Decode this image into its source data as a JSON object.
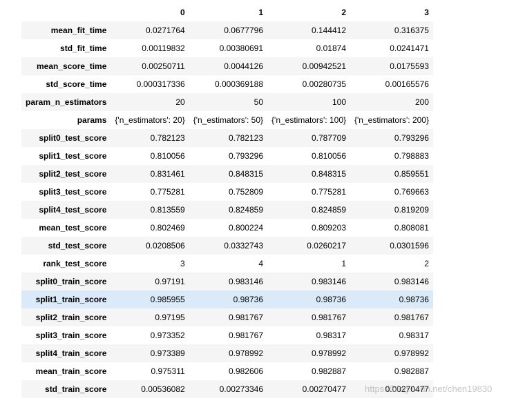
{
  "table": {
    "columns": [
      "0",
      "1",
      "2",
      "3"
    ],
    "hover_row_index": 15,
    "rows": [
      {
        "label": "mean_fit_time",
        "values": [
          "0.0271764",
          "0.0677796",
          "0.144412",
          "0.316375"
        ]
      },
      {
        "label": "std_fit_time",
        "values": [
          "0.00119832",
          "0.00380691",
          "0.01874",
          "0.0241471"
        ]
      },
      {
        "label": "mean_score_time",
        "values": [
          "0.00250711",
          "0.0044126",
          "0.00942521",
          "0.0175593"
        ]
      },
      {
        "label": "std_score_time",
        "values": [
          "0.000317336",
          "0.000369188",
          "0.00280735",
          "0.00165576"
        ]
      },
      {
        "label": "param_n_estimators",
        "values": [
          "20",
          "50",
          "100",
          "200"
        ]
      },
      {
        "label": "params",
        "values": [
          "{'n_estimators': 20}",
          "{'n_estimators': 50}",
          "{'n_estimators': 100}",
          "{'n_estimators': 200}"
        ]
      },
      {
        "label": "split0_test_score",
        "values": [
          "0.782123",
          "0.782123",
          "0.787709",
          "0.793296"
        ]
      },
      {
        "label": "split1_test_score",
        "values": [
          "0.810056",
          "0.793296",
          "0.810056",
          "0.798883"
        ]
      },
      {
        "label": "split2_test_score",
        "values": [
          "0.831461",
          "0.848315",
          "0.848315",
          "0.859551"
        ]
      },
      {
        "label": "split3_test_score",
        "values": [
          "0.775281",
          "0.752809",
          "0.775281",
          "0.769663"
        ]
      },
      {
        "label": "split4_test_score",
        "values": [
          "0.813559",
          "0.824859",
          "0.824859",
          "0.819209"
        ]
      },
      {
        "label": "mean_test_score",
        "values": [
          "0.802469",
          "0.800224",
          "0.809203",
          "0.808081"
        ]
      },
      {
        "label": "std_test_score",
        "values": [
          "0.0208506",
          "0.0332743",
          "0.0260217",
          "0.0301596"
        ]
      },
      {
        "label": "rank_test_score",
        "values": [
          "3",
          "4",
          "1",
          "2"
        ]
      },
      {
        "label": "split0_train_score",
        "values": [
          "0.97191",
          "0.983146",
          "0.983146",
          "0.983146"
        ]
      },
      {
        "label": "split1_train_score",
        "values": [
          "0.985955",
          "0.98736",
          "0.98736",
          "0.98736"
        ]
      },
      {
        "label": "split2_train_score",
        "values": [
          "0.97195",
          "0.981767",
          "0.981767",
          "0.981767"
        ]
      },
      {
        "label": "split3_train_score",
        "values": [
          "0.973352",
          "0.981767",
          "0.98317",
          "0.98317"
        ]
      },
      {
        "label": "split4_train_score",
        "values": [
          "0.973389",
          "0.978992",
          "0.978992",
          "0.978992"
        ]
      },
      {
        "label": "mean_train_score",
        "values": [
          "0.975311",
          "0.982606",
          "0.982887",
          "0.982887"
        ]
      },
      {
        "label": "std_train_score",
        "values": [
          "0.00536082",
          "0.00273346",
          "0.00270477",
          "0.00270477"
        ]
      }
    ]
  },
  "watermark": {
    "text": "https://blog.csdn.net/chen19830"
  }
}
